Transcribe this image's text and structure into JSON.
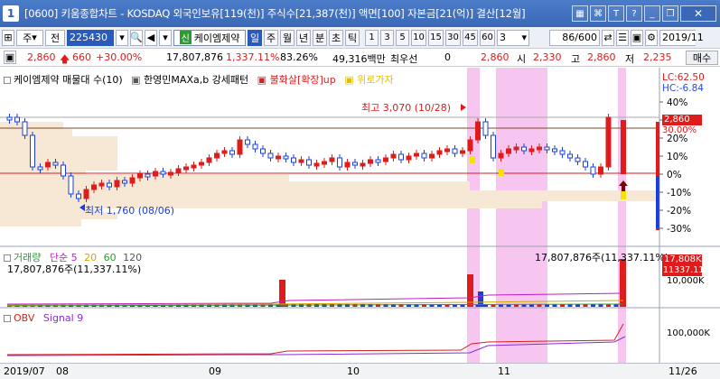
{
  "window": {
    "badge": "1",
    "title": "[0600] 키움종합차트 - KOSDAQ 외국인보유[119(천)] 주식수[21,387(천)] 액면[100] 자본금[21(억)] 결산[12월]",
    "icons": [
      "grid-icon",
      "link-icon",
      "t-icon",
      "help-icon",
      "minimize-icon",
      "restore-icon"
    ],
    "close": "✕"
  },
  "toolbar": {
    "dropdown_label": "주",
    "prev_label": "전",
    "stock_code": "225430",
    "stock_name": "케이엠제약",
    "new_badge": "신",
    "periods": [
      "일",
      "주",
      "월",
      "년",
      "분",
      "초",
      "틱"
    ],
    "active_period": "일",
    "intervals": [
      "1",
      "3",
      "5",
      "10",
      "15",
      "30",
      "45",
      "60"
    ],
    "selected_interval": "3",
    "count": "86",
    "total": "/600",
    "date": "2019/11"
  },
  "info": {
    "price": "2,860",
    "change": "660",
    "change_pct": "+30.00%",
    "volume": "17,807,876",
    "volume_pct": "1,337.11%",
    "rate": "83.26%",
    "amount": "49,316백만",
    "dealer_label": "최우선",
    "dealer_value": "0",
    "current": "2,860",
    "open_label": "시",
    "open": "2,330",
    "high_label": "고",
    "high": "2,860",
    "low_label": "저",
    "low": "2,235",
    "buy_button": "매수"
  },
  "price_pane": {
    "legend_name": "케이엠제약 매물대 수(10)",
    "ind1": "한영민MAXa,b 강세패턴",
    "ind2": "불화살[확장]up",
    "ind3": "위로가자",
    "lc": "LC:62.50",
    "hc": "HC:-6.84",
    "high_note": "최고 3,070 (10/28)",
    "low_note": "최저 1,760 (08/06)",
    "price_tag": "2,860",
    "pct_tag": "30.00%",
    "pct_ticks": [
      "40%",
      "30%",
      "20%",
      "10%",
      "0%",
      "-10%",
      "-20%",
      "-30%"
    ]
  },
  "volume_pane": {
    "label": "거래량",
    "ma_label": "단순",
    "ma_values": [
      "5",
      "20",
      "60",
      "120"
    ],
    "left_value": "17,807,876주(11,337.11%)",
    "right_value": "17,807,876주(11,337.11%)",
    "tag1": "17,808K",
    "tag2": "11337.11%",
    "tick": "10,000K"
  },
  "obv_pane": {
    "label": "OBV",
    "signal": "Signal 9",
    "tick": "100,000K"
  },
  "x_axis": {
    "labels": [
      "2019/07",
      "08",
      "09",
      "10",
      "11",
      "11/26"
    ]
  },
  "colors": {
    "up": "#e01b1b",
    "down": "#1a3fd6",
    "highlight": "#f6c6f0",
    "title_bar": "#3a68b6"
  }
}
